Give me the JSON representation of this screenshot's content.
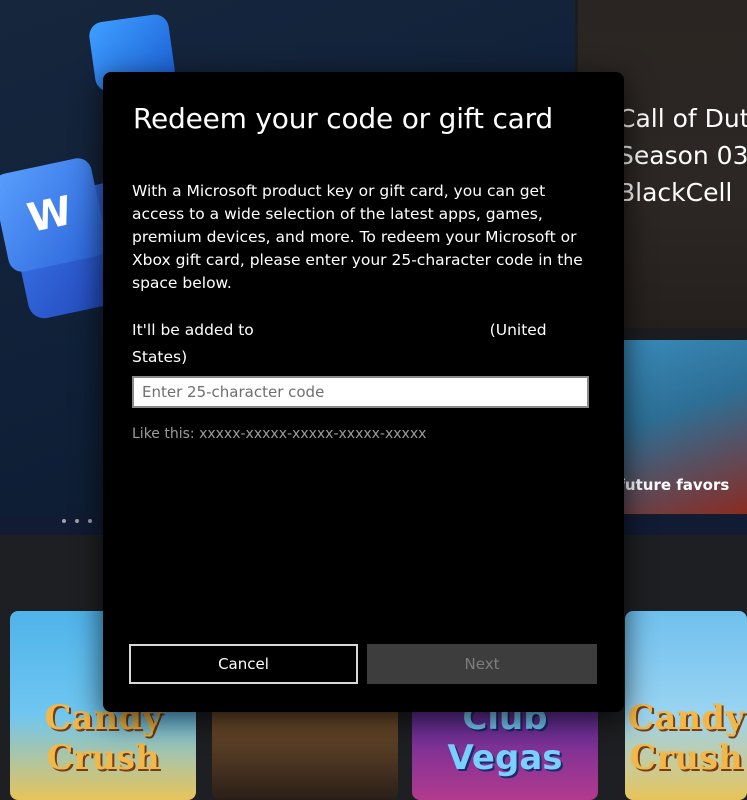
{
  "background": {
    "hero_dots": 3,
    "side_card": {
      "title_lines": [
        "Call of Dut",
        "Season 03",
        "BlackCell"
      ]
    },
    "side_card2": {
      "caption": "e future favors"
    },
    "game_tiles": [
      {
        "name": "candy-crush-saga",
        "text": "Candy Crush"
      },
      {
        "name": "dark-fantasy-game",
        "text": ""
      },
      {
        "name": "club-vegas",
        "text": "Club Vegas"
      },
      {
        "name": "candy-crush",
        "text": "Candy Crush"
      }
    ]
  },
  "dialog": {
    "title": "Redeem your code or gift card",
    "description": "With a Microsoft product key or gift card, you can get access to a wide selection of the latest apps, games, premium devices, and more. To redeem your Microsoft or Xbox gift card, please enter your 25-character code in the space below.",
    "account_prefix": "It'll be added to",
    "account_suffix": "(United States)",
    "code_input": {
      "value": "",
      "placeholder": "Enter 25-character code"
    },
    "hint": "Like this: xxxxx-xxxxx-xxxxx-xxxxx-xxxxx",
    "buttons": {
      "cancel": "Cancel",
      "next": "Next"
    }
  }
}
